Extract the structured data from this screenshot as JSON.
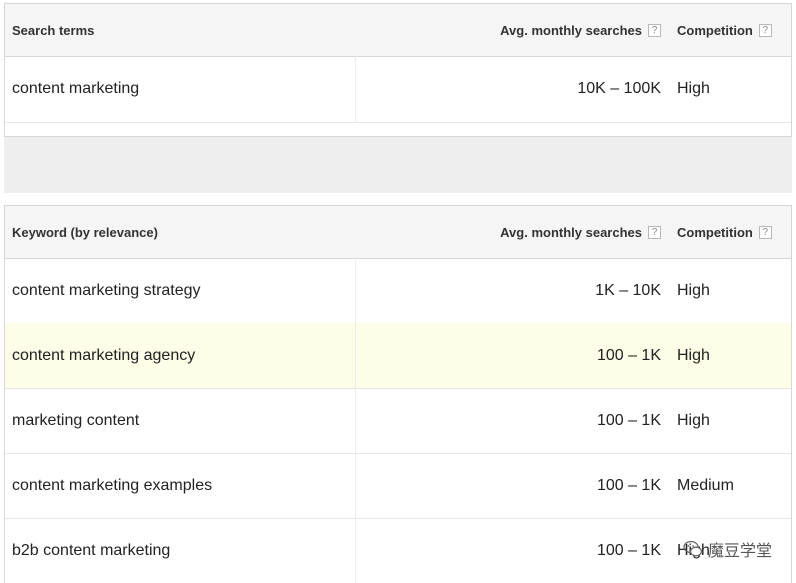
{
  "search_table": {
    "headers": {
      "term": "Search terms",
      "avg": "Avg. monthly searches",
      "competition": "Competition",
      "help": "?"
    },
    "rows": [
      {
        "term": "content marketing",
        "avg": "10K – 100K",
        "competition": "High"
      }
    ]
  },
  "keyword_table": {
    "headers": {
      "term": "Keyword (by relevance)",
      "avg": "Avg. monthly searches",
      "competition": "Competition",
      "help": "?"
    },
    "rows": [
      {
        "term": "content marketing strategy",
        "avg": "1K – 10K",
        "competition": "High"
      },
      {
        "term": "content marketing agency",
        "avg": "100 – 1K",
        "competition": "High"
      },
      {
        "term": "marketing content",
        "avg": "100 – 1K",
        "competition": "High"
      },
      {
        "term": "content marketing examples",
        "avg": "100 – 1K",
        "competition": "Medium"
      },
      {
        "term": "b2b content marketing",
        "avg": "100 – 1K",
        "competition": "High"
      }
    ]
  },
  "watermark": {
    "text": "魔豆学堂",
    "icon": "wechat-icon"
  }
}
